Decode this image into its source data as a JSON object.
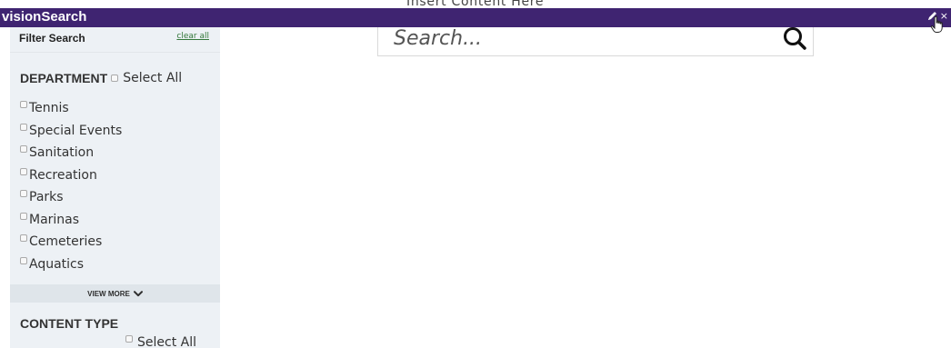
{
  "background_text": "Insert Content Here",
  "topbar": {
    "brand": "visionSearch",
    "edit_icon": "pencil-icon",
    "close_glyph": "×",
    "bar_color": "#3f2471",
    "cursor_icon": "hand-cursor-icon"
  },
  "sidebar": {
    "filter_search_label": "Filter Search",
    "clear_all_label": "clear all",
    "department": {
      "title": "DEPARTMENT",
      "select_all_label": "Select All",
      "items": [
        {
          "label": "Tennis"
        },
        {
          "label": "Special Events"
        },
        {
          "label": "Sanitation"
        },
        {
          "label": "Recreation"
        },
        {
          "label": "Parks"
        },
        {
          "label": "Marinas"
        },
        {
          "label": "Cemeteries"
        },
        {
          "label": "Aquatics"
        }
      ],
      "view_more_label": "VIEW MORE",
      "view_more_icon": "chevron-down-icon"
    },
    "content_type": {
      "title": "CONTENT TYPE",
      "select_all_label": "Select All"
    },
    "background_color": "#edf1f5"
  },
  "search": {
    "value": "",
    "placeholder": "Search...",
    "icon": "search-icon"
  }
}
